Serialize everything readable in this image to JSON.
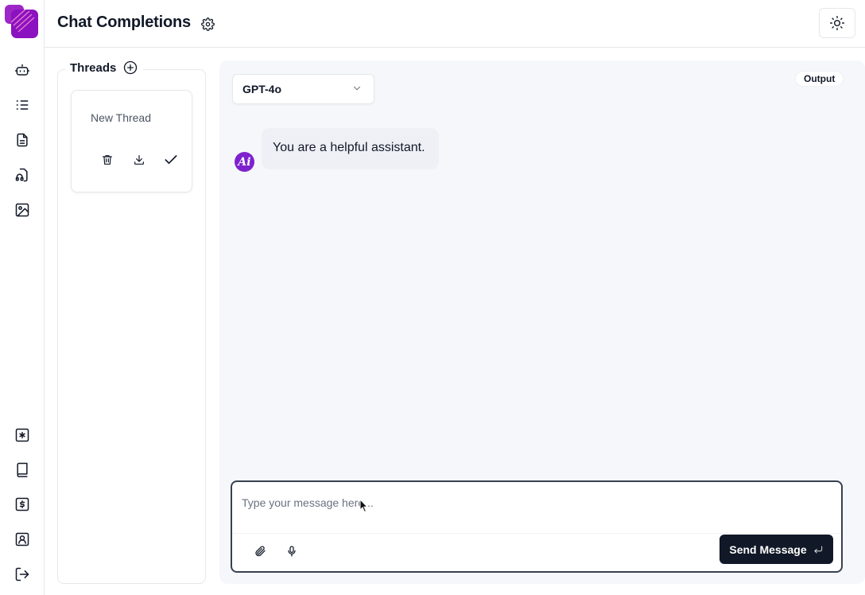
{
  "app": {
    "title": "Chat Completions",
    "brand_color": "#7e22ce"
  },
  "rail": {
    "top_items": [
      {
        "icon": "bot-icon"
      },
      {
        "icon": "list-icon"
      },
      {
        "icon": "document-icon"
      },
      {
        "icon": "headphones-file-icon"
      },
      {
        "icon": "image-icon"
      }
    ],
    "bottom_items": [
      {
        "icon": "asterisk-box-icon"
      },
      {
        "icon": "book-icon"
      },
      {
        "icon": "dollar-box-icon"
      },
      {
        "icon": "user-box-icon"
      },
      {
        "icon": "logout-icon"
      }
    ]
  },
  "header": {
    "settings_icon": "gear-icon",
    "theme_icon": "sun-icon"
  },
  "threads": {
    "title": "Threads",
    "items": [
      {
        "name": "New Thread"
      }
    ]
  },
  "chat": {
    "model": "GPT-4o",
    "output_badge": "Output",
    "messages": [
      {
        "role": "system",
        "avatar": "Ai",
        "text": "You are a helpful assistant."
      }
    ]
  },
  "composer": {
    "placeholder": "Type your message here...",
    "value": "",
    "send_label": "Send Message"
  }
}
